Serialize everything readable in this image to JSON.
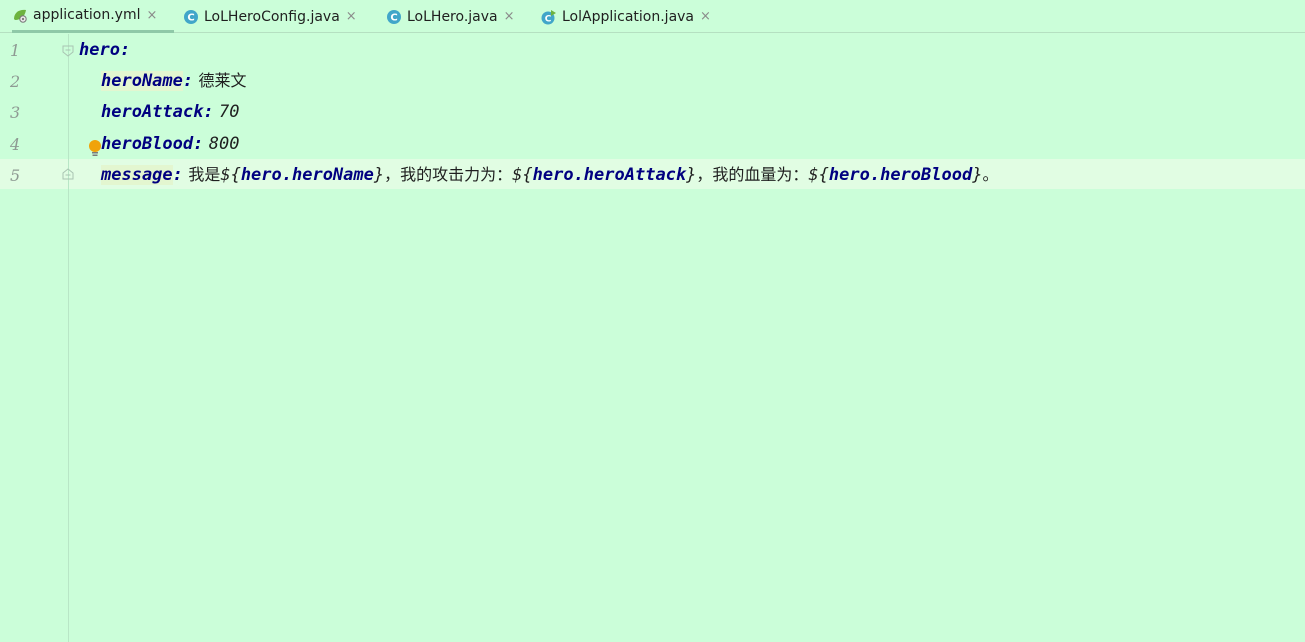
{
  "tabs": [
    {
      "label": "application.yml",
      "icon": "spring-yaml-icon",
      "active": true
    },
    {
      "label": "LoLHeroConfig.java",
      "icon": "java-class-icon",
      "active": false
    },
    {
      "label": "LoLHero.java",
      "icon": "java-class-icon",
      "active": false
    },
    {
      "label": "LolApplication.java",
      "icon": "spring-boot-app-icon",
      "active": false
    }
  ],
  "tab_close_glyph": "×",
  "colors": {
    "editor_background": "#cbfed9",
    "current_line": "#e1fde3",
    "yaml_key": "#000080",
    "bulb": "#f0a30a"
  },
  "editor": {
    "line_numbers": [
      "1",
      "2",
      "3",
      "4",
      "5"
    ],
    "lines": [
      {
        "key": "hero",
        "colon": ":"
      },
      {
        "key": "heroName",
        "colon": ":",
        "value": "德莱文"
      },
      {
        "key": "heroAttack",
        "colon": ":",
        "value": "70"
      },
      {
        "key": "heroBlood",
        "colon": ":",
        "value": "800"
      },
      {
        "key": "message",
        "colon": ":",
        "seg1": "我是",
        "ph1_open": "${",
        "ph1_name": "hero.heroName",
        "ph1_close": "}",
        "seg2": "，我的攻击力为：",
        "ph2_open": "${",
        "ph2_name": "hero.heroAttack",
        "ph2_close": "}",
        "seg3": "，我的血量为：",
        "ph3_open": "${",
        "ph3_name": "hero.heroBlood",
        "ph3_close": "}",
        "seg4": "。"
      }
    ]
  }
}
